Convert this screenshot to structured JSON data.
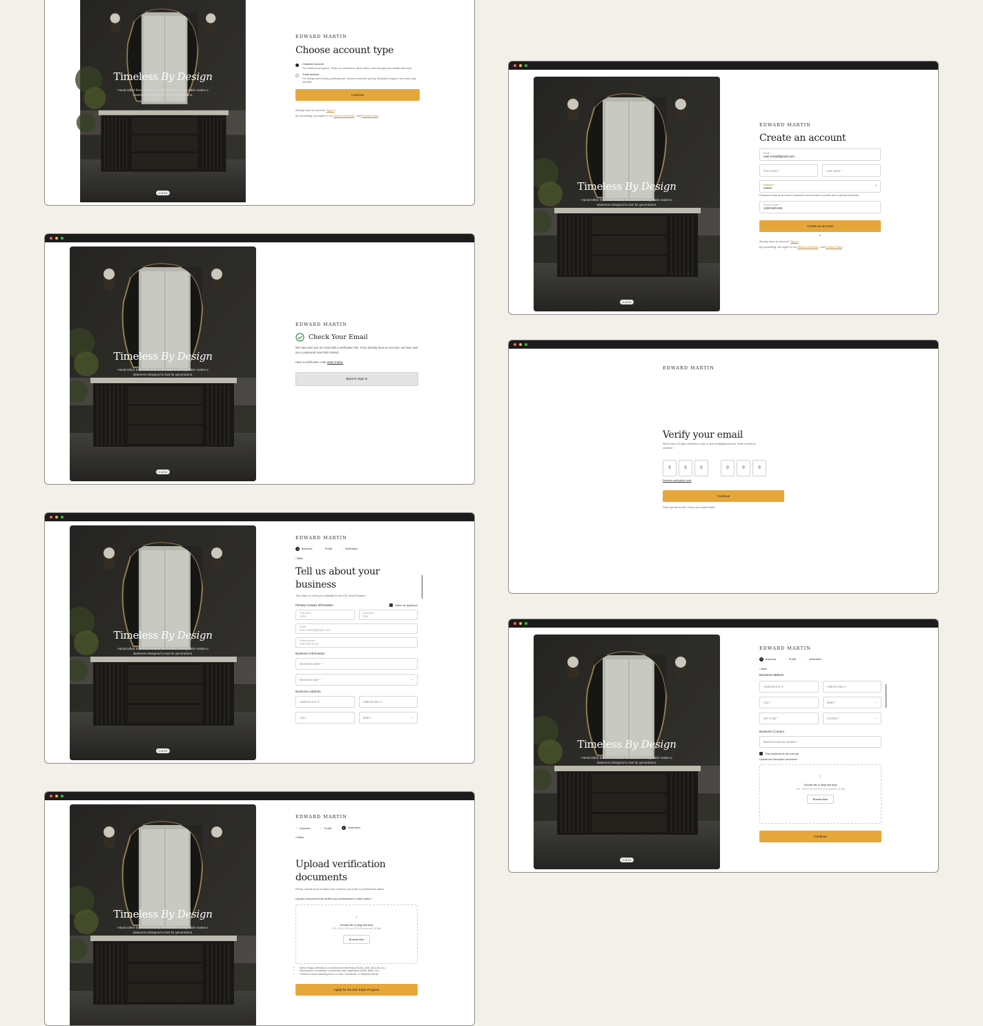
{
  "brand": "EDWARD MARTIN",
  "hero": {
    "title_plain": "Timeless ",
    "title_italic": "By Design",
    "subtitle": "Handcrafted from solid walnut, the Bastien Dining Table makes a statement designed to last for generations.",
    "pager": "1 of 12"
  },
  "colors": {
    "accent": "#e6a73a",
    "background": "#f3efe9",
    "titlebar": "#1c1c1c"
  },
  "account_type": {
    "title": "Choose account type",
    "options": [
      {
        "label": "Customer account",
        "desc": "For individual shoppers. Shop our collections, track orders, and manage your details with ease.",
        "selected": true
      },
      {
        "label": "Trade account",
        "desc": "For design and industry professionals. Access exclusive pricing, dedicated support, and trade-only benefits.",
        "selected": false
      }
    ],
    "continue": "Continue",
    "already": "Already have an account?",
    "sign_in": "Sign in",
    "proceeding": "By proceeding, you agree to our",
    "terms": "Terms of Services",
    "and": "and",
    "privacy": "Privacy Policy"
  },
  "create_account": {
    "title": "Create an account",
    "email_label": "Email *",
    "email_value": "user-email@gmail.com",
    "first_name": "First name *",
    "last_name": "Last name *",
    "password_label": "Password *",
    "password_value": "••••••••",
    "password_hint": "Password must be at least 8 characters and include a number and a special character.",
    "phone_label": "Phone number *",
    "phone_value": "1230-540-634",
    "button": "Create an account",
    "or": "or",
    "already": "Already have an account?",
    "sign_in": "Sign in",
    "proceeding": "By proceeding, you agree to our",
    "terms": "Terms of Services",
    "and": "and",
    "privacy": "Privacy Policy"
  },
  "check_email": {
    "title": "Check Your Email",
    "body": "We have sent you an email with a verification link. If you already have an account, we have sent you a password reset link instead.",
    "code_prompt": "Have a verification code",
    "code_link": "enter it here.",
    "button": "Back to Sign In"
  },
  "verify_email": {
    "title": "Verify your email",
    "body": "We've sent a 6-digit verification code to user-email@gmail.com. Enter it below to continue.",
    "digits": [
      "0",
      "0",
      "0",
      "0",
      "0",
      "0"
    ],
    "separator": "-",
    "resend": "Resend verification code",
    "button": "Continue",
    "spam": "Didn't get the email? Check your spam folder."
  },
  "steps": {
    "business": "Business",
    "profile": "Profile",
    "verification": "Verification",
    "back": "Back"
  },
  "business": {
    "title_line1": "Tell us about your",
    "title_line2": "business",
    "subtitle": "This helps us verify your eligibility for the EM Trade Program.",
    "primary_contact": "Primary Contact Information",
    "same_as": "Same as applicant",
    "first_name_label": "First name *",
    "first_name_value": "John",
    "last_name_label": "Last name *",
    "last_name_value": "Doe",
    "email_label": "Email *",
    "email_value": "user-email@gmail.com",
    "phone_label": "Phone number *",
    "phone_value": "333-333-4444",
    "business_info": "Business Information",
    "business_name": "Business name *",
    "business_type": "Business type *",
    "business_address": "Business Address",
    "address1": "Address line 1*",
    "address2": "Address line 2",
    "city": "City *",
    "state": "State *"
  },
  "address": {
    "section": "Business Address",
    "address1": "Address line 1*",
    "address2": "Address line 2",
    "city": "City *",
    "state": "State *",
    "zip": "ZIP Code *",
    "country": "Country *",
    "contact": "Business Contact",
    "phone": "Business phone number *",
    "tax_exempt": "This business is tax exempt",
    "upload_label": "Upload tax exemption document *",
    "choose": "Choose file or drag and drop",
    "formats": "JPG, JPEG, PNG and PDF (File size limit: 20 MB)",
    "browse": "Browse files",
    "button": "Continue"
  },
  "upload": {
    "title_line1": "Upload verification",
    "title_line2": "documents",
    "subtitle": "Please upload documentation that confirms your trade or professional status.",
    "upload_label": "Upload a document that verifies your professional or trade status *",
    "choose": "Choose file or drag and drop",
    "formats": "JPG, JPEG, PNG and PDF (File size limit: 20 MB)",
    "browse": "Browse files",
    "bullets": [
      "Interior design certifications or professional memberships (NCIDQ, ASID, IIDA, AIA, etc.)",
      "Membership in a residential or commercial trade organization (NAHB, NKBA, etc.)",
      "A business license indicating work in a Trade, Commercial, or Hospitality industry"
    ],
    "button": "Apply for the EM Trade Program"
  }
}
